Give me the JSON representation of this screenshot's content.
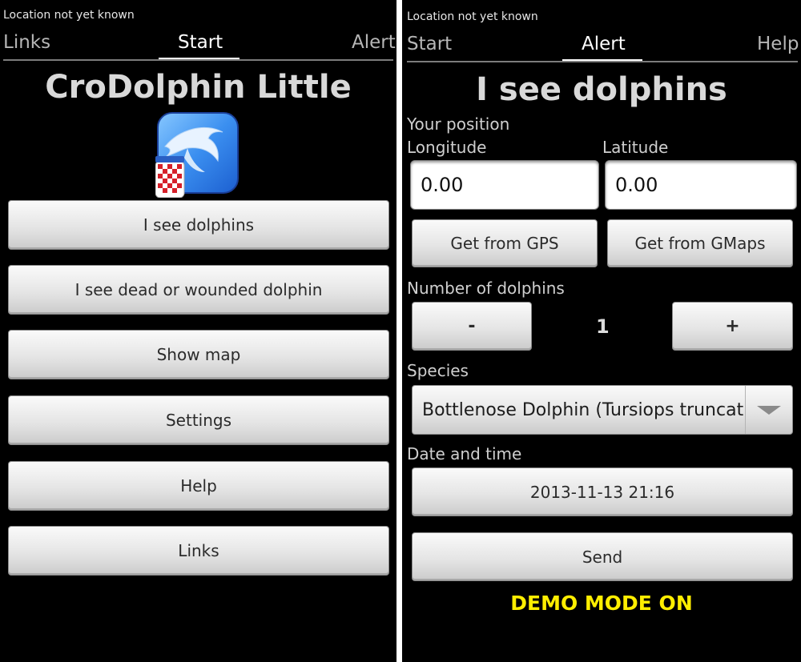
{
  "start_screen": {
    "status_text": "Location not yet known",
    "tabs": [
      {
        "label": "Links"
      },
      {
        "label": "Start"
      },
      {
        "label": "Alert"
      }
    ],
    "active_tab": "Start",
    "title": "CroDolphin Little",
    "logo_icon": "dolphin-croatia-logo",
    "menu": [
      {
        "label": "I see dolphins"
      },
      {
        "label": "I see dead or wounded dolphin"
      },
      {
        "label": "Show map"
      },
      {
        "label": "Settings"
      },
      {
        "label": "Help"
      },
      {
        "label": "Links"
      }
    ]
  },
  "alert_screen": {
    "status_text": "Location not yet known",
    "tabs": [
      {
        "label": "Start"
      },
      {
        "label": "Alert"
      },
      {
        "label": "Help"
      }
    ],
    "active_tab": "Alert",
    "title": "I see dolphins",
    "position_label": "Your position",
    "longitude_label": "Longitude",
    "latitude_label": "Latitude",
    "longitude_value": "0.00",
    "latitude_value": "0.00",
    "gps_button": "Get from GPS",
    "gmaps_button": "Get from GMaps",
    "count_label": "Number of dolphins",
    "minus_label": "-",
    "plus_label": "+",
    "count_value": "1",
    "species_label": "Species",
    "species_value": "Bottlenose Dolphin (Tursiops truncatus)",
    "datetime_label": "Date and time",
    "datetime_value": "2013-11-13 21:16",
    "send_button": "Send",
    "demo_text": "DEMO MODE ON"
  },
  "colors": {
    "background": "#000000",
    "demo_text": "#ffee00",
    "title_text": "#d9d9d9"
  }
}
